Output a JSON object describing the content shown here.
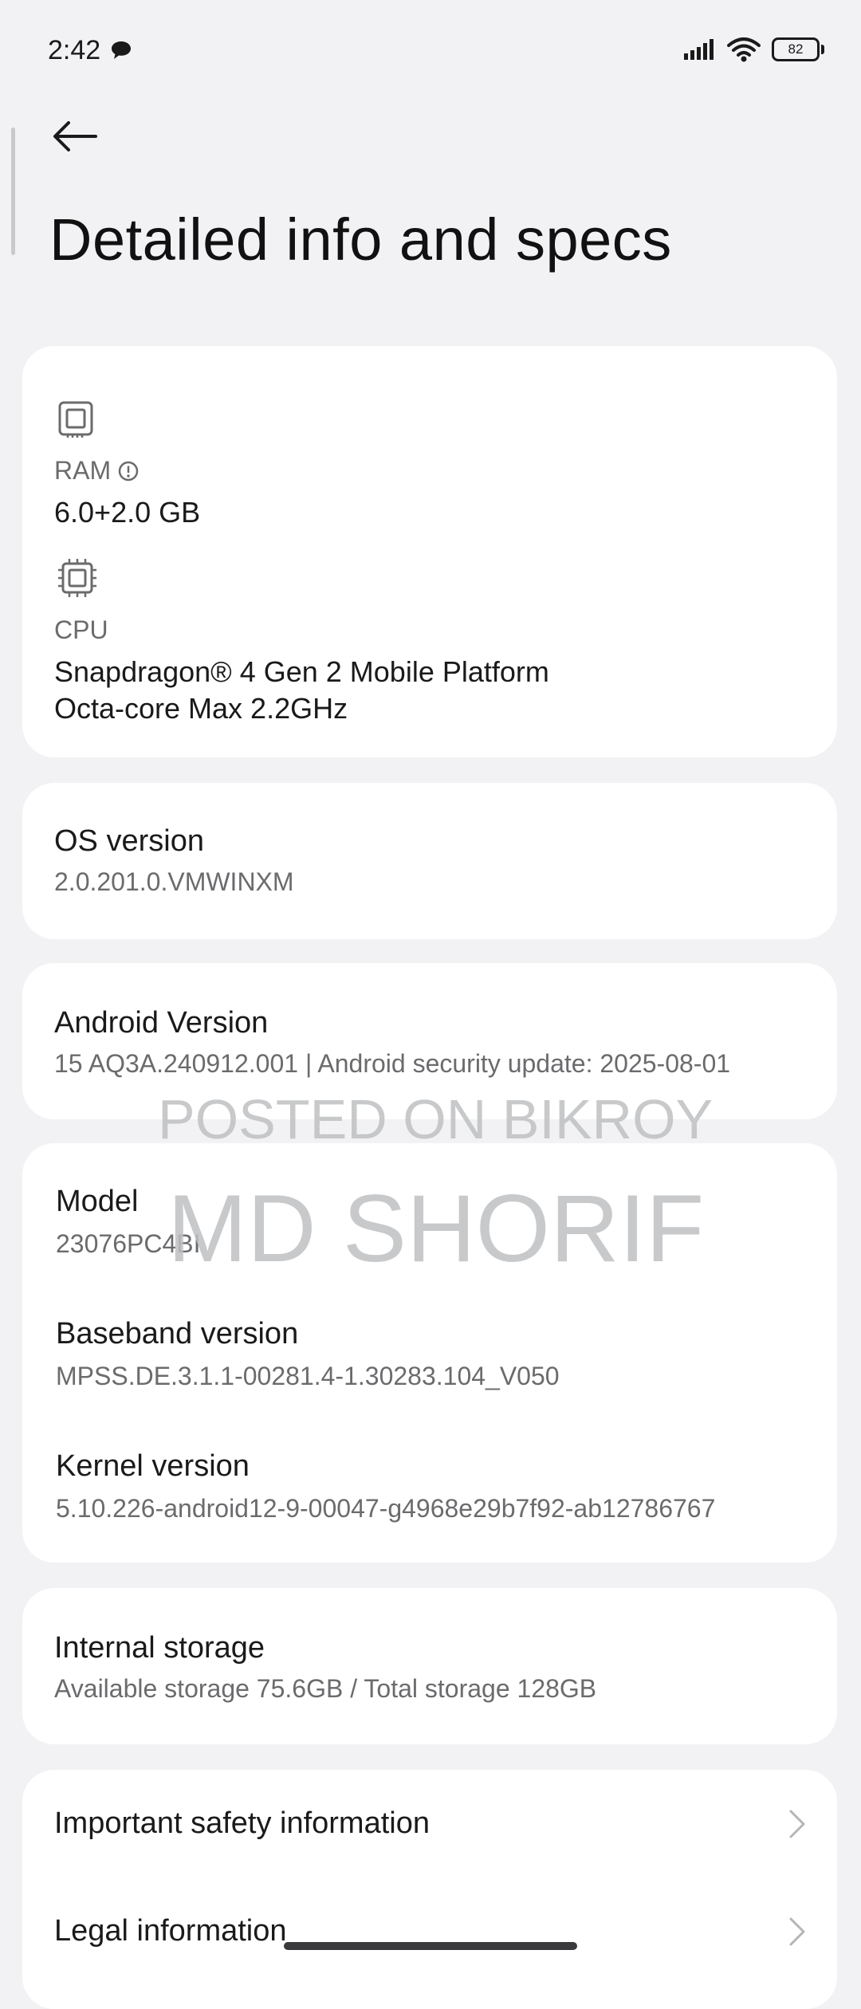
{
  "status_bar": {
    "time": "2:42",
    "battery": "82"
  },
  "header": {
    "title": "Detailed info and specs"
  },
  "hardware": {
    "ram_label": "RAM",
    "ram_value": "6.0+2.0 GB",
    "cpu_label": "CPU",
    "cpu_line1": "Snapdragon® 4 Gen 2 Mobile Platform",
    "cpu_line2": "Octa-core Max 2.2GHz"
  },
  "os": {
    "label": "OS version",
    "value": "2.0.201.0.VMWINXM"
  },
  "android": {
    "label": "Android Version",
    "value": "15 AQ3A.240912.001 | Android security update: 2025-08-01"
  },
  "device": {
    "model_label": "Model",
    "model_value": "23076PC4BI",
    "baseband_label": "Baseband version",
    "baseband_value": "MPSS.DE.3.1.1-00281.4-1.30283.104_V050",
    "kernel_label": "Kernel version",
    "kernel_value": "5.10.226-android12-9-00047-g4968e29b7f92-ab12786767"
  },
  "storage": {
    "label": "Internal storage",
    "value": "Available storage  75.6GB / Total storage  128GB"
  },
  "links": [
    {
      "label": "Important safety information"
    },
    {
      "label": "Legal information"
    }
  ],
  "watermark": {
    "line1": "POSTED ON BIKROY",
    "line2": "MD SHORIF"
  }
}
